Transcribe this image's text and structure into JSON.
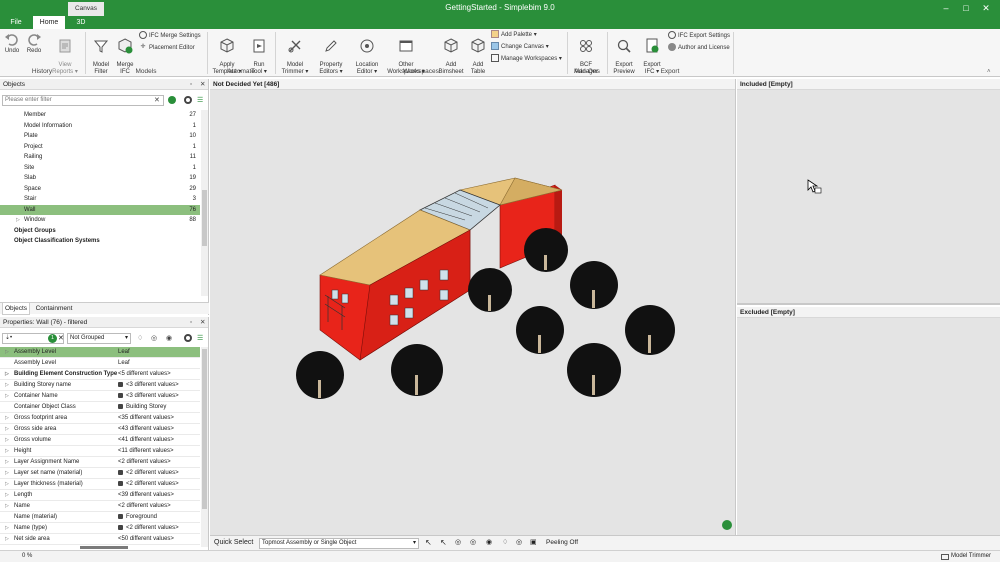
{
  "window": {
    "title": "GettingStarted - Simplebim 9.0",
    "context_tab": "Canvas"
  },
  "tabs": [
    {
      "label": "File"
    },
    {
      "label": "Home"
    },
    {
      "label": "3D"
    }
  ],
  "ribbon": {
    "history": {
      "group": "History",
      "undo": "Undo",
      "redo": "Redo",
      "view_reports": "View\nReports ▾"
    },
    "models": {
      "group": "Models",
      "model_filter": "Model\nFilter",
      "merge_ifc": "Merge\nIFC",
      "ifc_merge_settings": "IFC Merge Settings",
      "placement_editor": "Placement Editor"
    },
    "automate": {
      "group": "Automate",
      "apply_template": "Apply\nTemplate ▾",
      "run_tool": "Run\nTool ▾"
    },
    "workspaces": {
      "group": "Workspaces",
      "model_trimmer": "Model\nTrimmer ▾",
      "property_editors": "Property\nEditors ▾",
      "location_editor": "Location\nEditor ▾",
      "other_workspaces": "Other\nWorkspaces ▾",
      "add_bimsheet": "Add\nBimsheet",
      "add_table": "Add\nTable",
      "add_palette": "Add Palette ▾",
      "change_canvas": "Change Canvas ▾",
      "manage_workspaces": "Manage Workspaces ▾"
    },
    "addons": {
      "group": "Add-Ons",
      "bcf_manager": "BCF\nManager"
    },
    "export": {
      "group": "Export",
      "export_preview": "Export\nPreview",
      "export_ifc": "Export\nIFC ▾",
      "ifc_export_settings": "IFC Export Settings",
      "author_license": "Author and License"
    }
  },
  "objects_panel": {
    "title": "Objects",
    "filter_placeholder": "Please enter filter",
    "items": [
      {
        "label": "Member",
        "count": "27"
      },
      {
        "label": "Model Information",
        "count": "1"
      },
      {
        "label": "Plate",
        "count": "10"
      },
      {
        "label": "Project",
        "count": "1"
      },
      {
        "label": "Railing",
        "count": "11"
      },
      {
        "label": "Site",
        "count": "1"
      },
      {
        "label": "Slab",
        "count": "19"
      },
      {
        "label": "Space",
        "count": "29"
      },
      {
        "label": "Stair",
        "count": "3"
      },
      {
        "label": "Wall",
        "count": "76"
      },
      {
        "label": "Window",
        "count": "88"
      }
    ],
    "groups": [
      "Object Groups",
      "Object Classification Systems"
    ],
    "tabs": [
      "Objects",
      "Containment"
    ]
  },
  "properties_panel": {
    "title": "Properties: Wall (76) - filtered",
    "badge": "1",
    "grouping": "Not Grouped",
    "rows": [
      {
        "name": "Assembly Level",
        "value": "Leaf",
        "bold": false
      },
      {
        "name": "Assembly Level",
        "value": "Leaf",
        "bold": false
      },
      {
        "name": "Building Element Construction Type",
        "value": "<5 different values>",
        "bold": true
      },
      {
        "name": "Building Storey name",
        "value": "<3 different values>",
        "bold": false
      },
      {
        "name": "Container Name",
        "value": "<3 different values>",
        "bold": false
      },
      {
        "name": "Container Object Class",
        "value": "Building Storey",
        "bold": false
      },
      {
        "name": "Gross footprint area",
        "value": "<35 different values>",
        "bold": false
      },
      {
        "name": "Gross side area",
        "value": "<43 different values>",
        "bold": false
      },
      {
        "name": "Gross volume",
        "value": "<41 different values>",
        "bold": false
      },
      {
        "name": "Height",
        "value": "<11 different values>",
        "bold": false
      },
      {
        "name": "Layer Assignment Name",
        "value": "<2 different values>",
        "bold": false
      },
      {
        "name": "Layer set name (material)",
        "value": "<2 different values>",
        "bold": false
      },
      {
        "name": "Layer thickness (material)",
        "value": "<2 different values>",
        "bold": false
      },
      {
        "name": "Length",
        "value": "<39 different values>",
        "bold": false
      },
      {
        "name": "Name",
        "value": "<2 different values>",
        "bold": false
      },
      {
        "name": "Name (material)",
        "value": "Foreground",
        "bold": false
      },
      {
        "name": "Name (type)",
        "value": "<2 different values>",
        "bold": false
      },
      {
        "name": "Net side area",
        "value": "<50 different values>",
        "bold": false
      }
    ]
  },
  "canvas": {
    "header": "Not Decided Yet [486]"
  },
  "included_panel": {
    "header": "Included [Empty]"
  },
  "excluded_panel": {
    "header": "Excluded [Empty]"
  },
  "bottom_bar": {
    "quick_select_label": "Quick Select",
    "quick_select_value": "Topmost Assembly or Single Object",
    "peeling": "Peeling Off"
  },
  "status": {
    "progress": "0 %",
    "workspace": "Model Trimmer"
  },
  "colors": {
    "brand": "#2a8f3a",
    "selected_row": "#8cbf7e"
  }
}
